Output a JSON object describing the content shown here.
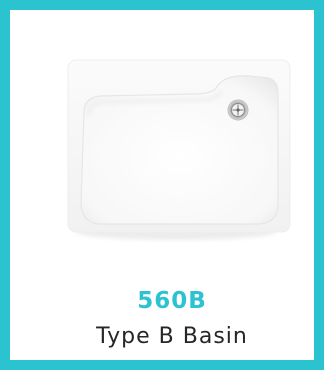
{
  "card": {
    "code": "560B",
    "name": "Type B Basin",
    "accent_color": "#2cc3d1",
    "image_icon": "basin-image"
  }
}
